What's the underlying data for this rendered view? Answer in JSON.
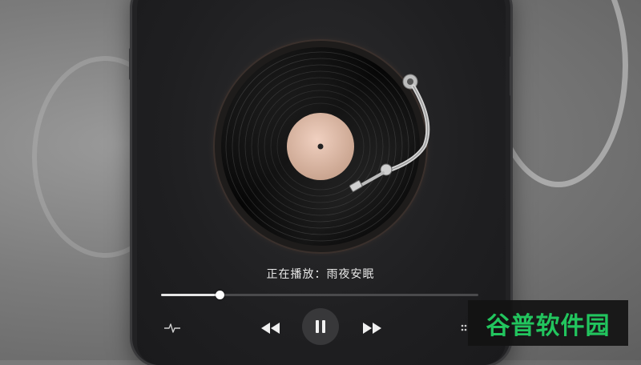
{
  "player": {
    "now_playing_label": "正在播放：雨夜安眠",
    "progress_fraction": 0.185
  },
  "controls": {
    "equalizer_icon": "waveform-icon",
    "previous_icon": "rewind-icon",
    "pause_icon": "pause-icon",
    "next_icon": "fast-forward-icon",
    "menu_icon": "dots-icon"
  },
  "watermark": {
    "text": "谷普软件园"
  },
  "colors": {
    "label_center": "#d8b6a3",
    "watermark_green": "#22c55e",
    "progress_fill": "#e6e6e6"
  }
}
